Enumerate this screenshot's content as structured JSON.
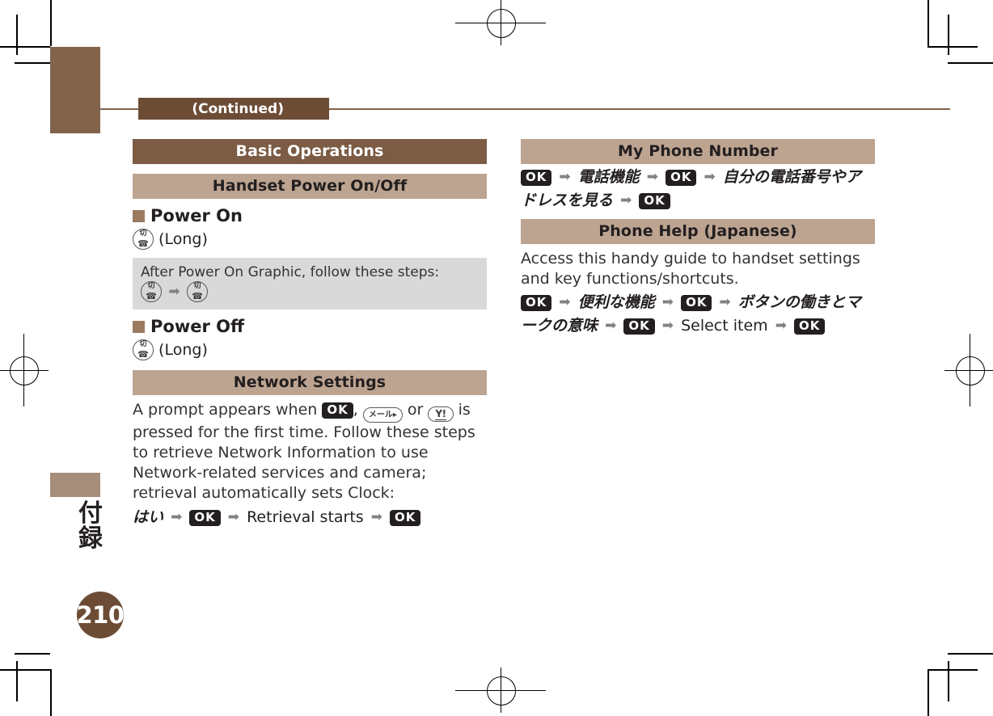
{
  "page": {
    "number": "210",
    "tab_label": "付録",
    "continued_label": "(Continued)"
  },
  "keys": {
    "ok": "OK",
    "power_top": "切",
    "power_bottom": "☎",
    "mail": "メール",
    "yahoo": "Y!",
    "arrow": "➡"
  },
  "left_column": {
    "section_title": "Basic Operations",
    "subsection_title": "Handset Power On/Off",
    "power_on": {
      "heading": "Power On",
      "modifier": "(Long)"
    },
    "note": {
      "text": "After Power On Graphic, follow these steps:"
    },
    "power_off": {
      "heading": "Power Off",
      "modifier": "(Long)"
    },
    "network_settings": {
      "title": "Network Settings",
      "paragraph_1": "A prompt appears when ",
      "paragraph_2": ", ",
      "paragraph_3": " or ",
      "paragraph_4": " is pressed for the first time. Follow these steps to retrieve Network Information to use Network-related services and camera; retrieval automatically sets Clock:",
      "step_yes": "はい",
      "step_retrieval": "Retrieval starts"
    }
  },
  "right_column": {
    "my_phone_number": {
      "title": "My Phone Number",
      "step_1": "電話機能",
      "step_2": "自分の電話番号やアドレスを見る"
    },
    "phone_help": {
      "title": "Phone Help (Japanese)",
      "paragraph": "Access this handy guide to handset settings and key functions/shortcuts.",
      "step_1": "便利な機能",
      "step_2": "ボタンの働きとマークの意味",
      "step_3": "Select item"
    }
  },
  "colors": {
    "dark_brown": "#7c5c44",
    "light_brown": "#bda491",
    "tab_brown": "#82634c",
    "badge_brown": "#6d4c36",
    "note_gray": "#d9d9d9"
  }
}
